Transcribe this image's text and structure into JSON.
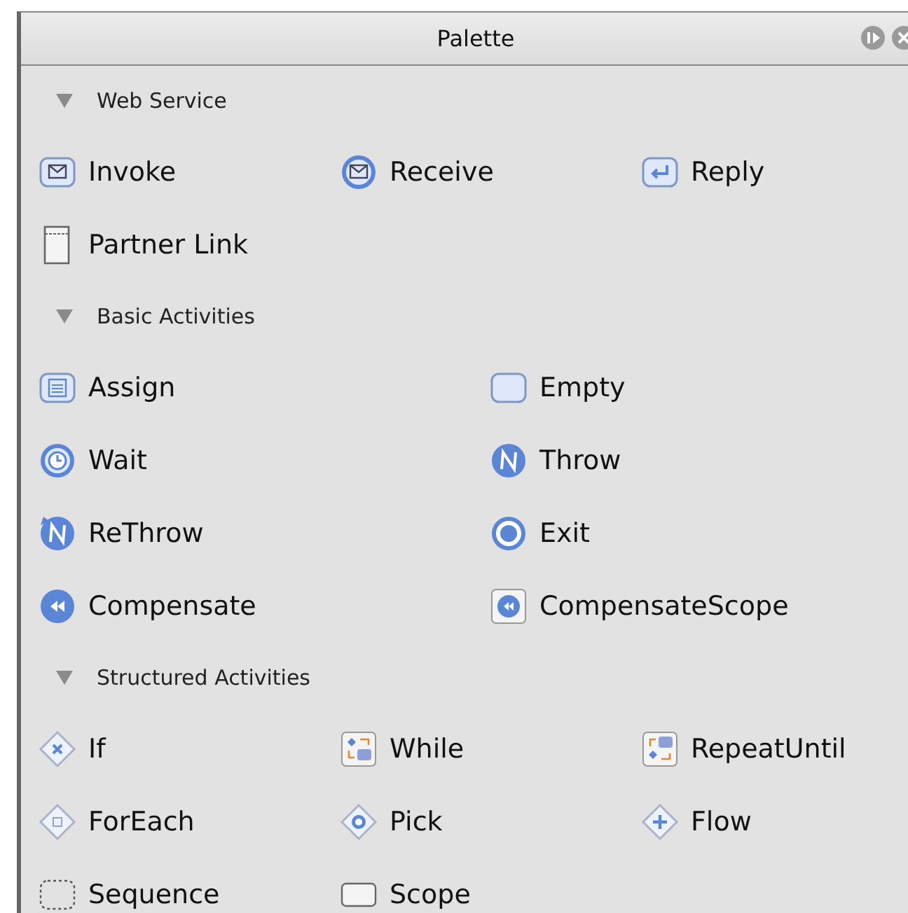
{
  "window": {
    "title": "Palette"
  },
  "sections": [
    {
      "title": "Web Service",
      "expanded": true,
      "kind": "three-column",
      "items": [
        {
          "label": "Invoke",
          "kind": "invoke"
        },
        {
          "label": "Receive",
          "kind": "receive"
        },
        {
          "label": "Reply",
          "kind": "reply"
        },
        {
          "label": "Partner Link",
          "kind": "partner-link"
        }
      ]
    },
    {
      "title": "Basic Activities",
      "expanded": true,
      "kind": "two-column",
      "items": [
        {
          "label": "Assign",
          "kind": "assign"
        },
        {
          "label": "Empty",
          "kind": "empty"
        },
        {
          "label": "Wait",
          "kind": "wait"
        },
        {
          "label": "Throw",
          "kind": "throw"
        },
        {
          "label": "ReThrow",
          "kind": "rethrow"
        },
        {
          "label": "Exit",
          "kind": "exit"
        },
        {
          "label": "Compensate",
          "kind": "compensate"
        },
        {
          "label": "CompensateScope",
          "kind": "compensate-scope"
        }
      ]
    },
    {
      "title": "Structured Activities",
      "expanded": true,
      "kind": "three-column",
      "items": [
        {
          "label": "If",
          "kind": "if"
        },
        {
          "label": "While",
          "kind": "while"
        },
        {
          "label": "RepeatUntil",
          "kind": "repeat-until"
        },
        {
          "label": "ForEach",
          "kind": "foreach"
        },
        {
          "label": "Pick",
          "kind": "pick"
        },
        {
          "label": "Flow",
          "kind": "flow"
        },
        {
          "label": "Sequence",
          "kind": "sequence"
        },
        {
          "label": "Scope",
          "kind": "scope"
        }
      ]
    }
  ]
}
